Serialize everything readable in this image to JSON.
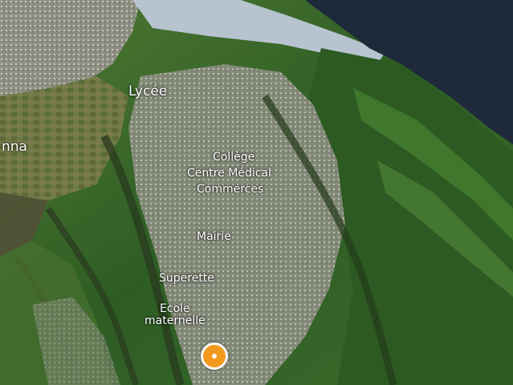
{
  "map": {
    "labels": {
      "lycee": "Lycée",
      "anna": "nna",
      "college": "Collège",
      "centre_medical": "Centre Médical",
      "commerces": "Commerces",
      "mairie": "Mairie",
      "superette": "Superette",
      "ecole_line1": "Ecole",
      "ecole_line2": "maternelle"
    },
    "marker": {
      "color": "#f29a1d",
      "icon": "location-marker-icon"
    },
    "colors": {
      "forest": "#2f5a22",
      "urban": "#9a9a8c",
      "river": "#b7c3cf",
      "water": "#1e2a3a",
      "fields": "#6f7a45"
    }
  }
}
